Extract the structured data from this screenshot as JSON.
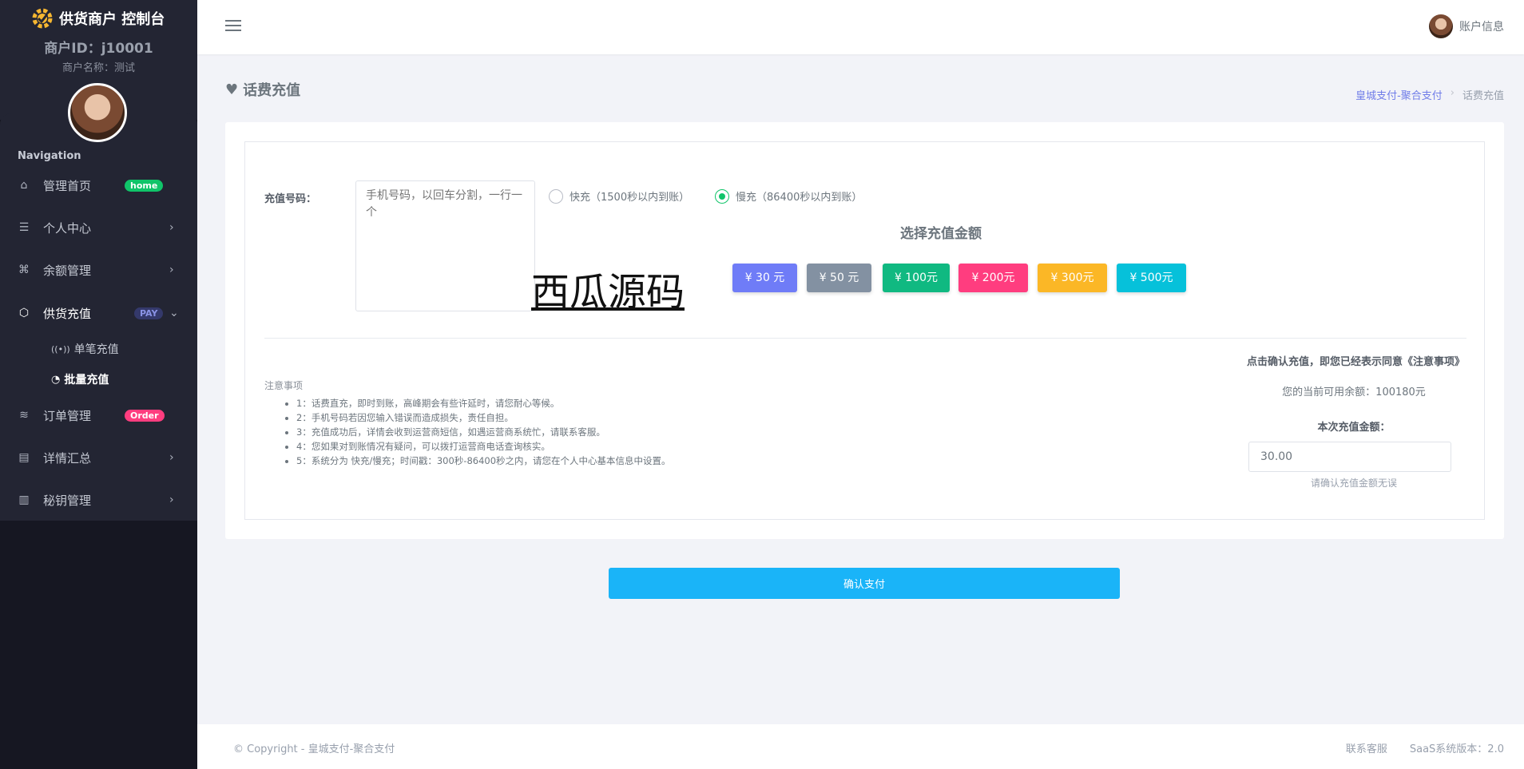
{
  "sidebar": {
    "brand": "供货商户 控制台",
    "merchant_id": "商户ID：j10001",
    "merchant_name": "商户名称：测试",
    "nav_title": "Navigation",
    "items": [
      {
        "label": "管理首页",
        "icon": "home-icon",
        "badge": "home",
        "badge_color": "#10c469"
      },
      {
        "label": "个人中心",
        "icon": "list-icon"
      },
      {
        "label": "余额管理",
        "icon": "command-icon"
      },
      {
        "label": "供货充值",
        "icon": "box-icon",
        "badge": "PAY",
        "badge_color": "#3f4d9c"
      },
      {
        "label": "订单管理",
        "icon": "layers-icon",
        "badge": "Order",
        "badge_color": "#ff5b5b"
      },
      {
        "label": "详情汇总",
        "icon": "document-icon"
      },
      {
        "label": "秘钥管理",
        "icon": "map-icon"
      }
    ],
    "sub_items": [
      {
        "label": "单笔充值",
        "icon": "broadcast-icon"
      },
      {
        "label": "批量充值",
        "icon": "gauge-icon"
      }
    ]
  },
  "header": {
    "account": "账户信息"
  },
  "page": {
    "title": "话费充值",
    "breadcrumb": [
      "皇城支付-聚合支付",
      "话费充值"
    ]
  },
  "form": {
    "number_label": "充值号码：",
    "number_placeholder": "手机号码，以回车分割，一行一个",
    "modes": [
      {
        "label": "快充（1500秒以内到账）",
        "selected": false
      },
      {
        "label": "慢充（86400秒以内到账）",
        "selected": true
      }
    ],
    "amount_title": "选择充值金额",
    "amounts": [
      {
        "label": "¥ 30 元",
        "color": "#6f7cf7"
      },
      {
        "label": "¥ 50 元",
        "color": "#8391a2"
      },
      {
        "label": "¥ 100元",
        "color": "#10b981"
      },
      {
        "label": "¥ 200元",
        "color": "#ff3d7f"
      },
      {
        "label": "¥ 300元",
        "color": "#fbb726"
      },
      {
        "label": "¥ 500元",
        "color": "#06c1da"
      }
    ],
    "watermark": "西瓜源码",
    "notice_title": "注意事项",
    "notices": [
      "1：话费直充，即时到账，高峰期会有些许延时，请您耐心等候。",
      "2：手机号码若因您输入错误而造成损失，责任自担。",
      "3：充值成功后，详情会收到运营商短信，如遇运营商系统忙，请联系客服。",
      "4：您如果对到账情况有疑问，可以拨打运营商电话查询核实。",
      "5：系统分为 快充/慢充；时间戳：300秒-86400秒之内，请您在个人中心基本信息中设置。"
    ],
    "agree_text": "点击确认充值，即您已经表示同意《注意事项》",
    "balance": "您的当前可用余额：100180元",
    "amount_label": "本次充值金额：",
    "amount_value": "30.00",
    "amount_help": "请确认充值金额无误",
    "pay_button": "确认支付"
  },
  "footer": {
    "copyright": "© Copyright - 皇城支付-聚合支付",
    "links": [
      "联系客服",
      "SaaS系统版本：2.0"
    ]
  }
}
